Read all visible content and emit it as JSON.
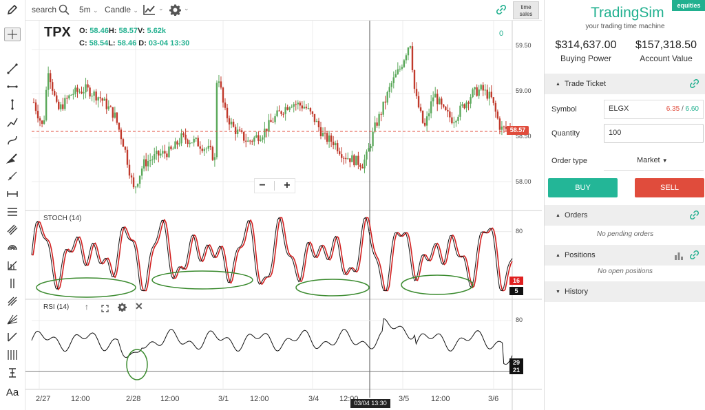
{
  "toolbar": {
    "search_label": "search",
    "interval": "5m",
    "chart_type": "Candle",
    "time_sales": [
      "time",
      "sales"
    ]
  },
  "symbol_overlay": {
    "symbol": "TPX",
    "o_label": "O:",
    "o_value": "58.46",
    "h_label": "H:",
    "h_value": "58.57",
    "v_label": "V:",
    "v_value": "5.62k",
    "c_label": "C:",
    "c_value": "58.54",
    "l_label": "L:",
    "l_value": "58.46",
    "d_label": "D:",
    "d_value": "03-04 13:30",
    "zero_label": "0"
  },
  "price_axis": {
    "ticks": [
      "59.50",
      "59.00",
      "58.50",
      "58.00"
    ],
    "current_price": "58.57"
  },
  "stoch_panel": {
    "label": "STOCH (14)",
    "tick": "80",
    "marker_red": "16",
    "marker_black": "5"
  },
  "rsi_panel": {
    "label": "RSI (14)",
    "tick": "80",
    "marker_high": "29",
    "marker_low": "21"
  },
  "time_axis": {
    "ticks": [
      "2/27",
      "12:00",
      "2/28",
      "12:00",
      "3/1",
      "12:00",
      "3/4",
      "12:00",
      "3/5",
      "12:00",
      "3/6"
    ],
    "crosshair_label": "03/04 13:30"
  },
  "zoom": {
    "minus": "−",
    "plus": "+"
  },
  "brand": {
    "name": "TradingSim",
    "tagline": "your trading time machine",
    "badge": "equities"
  },
  "account": {
    "buying_power_value": "$314,637.00",
    "buying_power_label": "Buying Power",
    "account_value_value": "$157,318.50",
    "account_value_label": "Account Value"
  },
  "trade_ticket": {
    "title": "Trade Ticket",
    "symbol_label": "Symbol",
    "symbol_value": "ELGX",
    "bid": "6.35",
    "separator": "/",
    "ask": "6.60",
    "quantity_label": "Quantity",
    "quantity_value": "100",
    "order_type_label": "Order type",
    "order_type_value": "Market",
    "buy_label": "BUY",
    "sell_label": "SELL"
  },
  "orders": {
    "title": "Orders",
    "empty": "No pending orders"
  },
  "positions": {
    "title": "Positions",
    "empty": "No open positions"
  },
  "history": {
    "title": "History"
  },
  "tool_names": [
    "cursor-crosshair",
    "trend-line",
    "horizontal-ray",
    "vertical-line",
    "polyline",
    "curve",
    "brush",
    "ray",
    "measure",
    "hlines",
    "channel",
    "spiral",
    "fib-grid",
    "parallel-lines",
    "pitchfork",
    "gann-fan",
    "triangle",
    "vlines",
    "text-tool",
    "font"
  ],
  "colors": {
    "brand": "#21b08f",
    "buy": "#23b697",
    "sell": "#e04c3c",
    "candle_up": "#5aa85a",
    "candle_down": "#c0392b",
    "price_line": "#e04c3c",
    "ellipse": "#3a8a2e",
    "badge": "#21b08f"
  },
  "chart_data": {
    "type": "candlestick",
    "title": "TPX",
    "interval": "5m",
    "x_tick_labels": [
      "2/27",
      "12:00",
      "2/28",
      "12:00",
      "3/1",
      "12:00",
      "3/4",
      "12:00",
      "3/5",
      "12:00",
      "3/6"
    ],
    "ylim": [
      57.75,
      59.75
    ],
    "y_ticks": [
      59.5,
      59.0,
      58.5,
      58.0
    ],
    "current_price": 58.57,
    "price_path": [
      {
        "t": 0.0,
        "p": 58.9
      },
      {
        "t": 0.02,
        "p": 58.6
      },
      {
        "t": 0.03,
        "p": 59.3
      },
      {
        "t": 0.05,
        "p": 58.8
      },
      {
        "t": 0.08,
        "p": 59.0
      },
      {
        "t": 0.11,
        "p": 59.05
      },
      {
        "t": 0.14,
        "p": 58.95
      },
      {
        "t": 0.17,
        "p": 58.75
      },
      {
        "t": 0.19,
        "p": 58.4
      },
      {
        "t": 0.21,
        "p": 57.9
      },
      {
        "t": 0.23,
        "p": 58.2
      },
      {
        "t": 0.26,
        "p": 58.3
      },
      {
        "t": 0.29,
        "p": 58.35
      },
      {
        "t": 0.31,
        "p": 58.5
      },
      {
        "t": 0.34,
        "p": 58.45
      },
      {
        "t": 0.37,
        "p": 58.35
      },
      {
        "t": 0.38,
        "p": 58.25
      },
      {
        "t": 0.385,
        "p": 59.3
      },
      {
        "t": 0.4,
        "p": 58.8
      },
      {
        "t": 0.42,
        "p": 58.6
      },
      {
        "t": 0.45,
        "p": 58.45
      },
      {
        "t": 0.48,
        "p": 58.55
      },
      {
        "t": 0.51,
        "p": 58.75
      },
      {
        "t": 0.54,
        "p": 58.9
      },
      {
        "t": 0.57,
        "p": 58.85
      },
      {
        "t": 0.59,
        "p": 58.7
      },
      {
        "t": 0.61,
        "p": 58.5
      },
      {
        "t": 0.63,
        "p": 58.45
      },
      {
        "t": 0.65,
        "p": 58.3
      },
      {
        "t": 0.67,
        "p": 58.25
      },
      {
        "t": 0.69,
        "p": 58.2
      },
      {
        "t": 0.7,
        "p": 58.3
      },
      {
        "t": 0.715,
        "p": 58.6
      },
      {
        "t": 0.73,
        "p": 58.8
      },
      {
        "t": 0.75,
        "p": 59.1
      },
      {
        "t": 0.77,
        "p": 59.3
      },
      {
        "t": 0.79,
        "p": 59.6
      },
      {
        "t": 0.8,
        "p": 59.0
      },
      {
        "t": 0.82,
        "p": 58.6
      },
      {
        "t": 0.84,
        "p": 59.0
      },
      {
        "t": 0.86,
        "p": 58.8
      },
      {
        "t": 0.88,
        "p": 58.7
      },
      {
        "t": 0.9,
        "p": 58.85
      },
      {
        "t": 0.92,
        "p": 59.0
      },
      {
        "t": 0.94,
        "p": 59.05
      },
      {
        "t": 0.96,
        "p": 58.95
      },
      {
        "t": 0.98,
        "p": 58.6
      }
    ],
    "stoch_ellipses": 4,
    "rsi_ellipses": 1
  }
}
